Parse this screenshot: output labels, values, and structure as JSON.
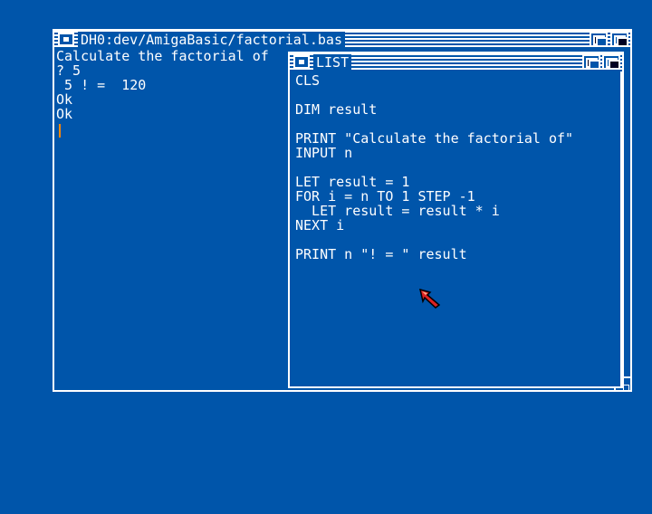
{
  "output_window": {
    "title": "DH0:dev/AmigaBasic/factorial.bas",
    "lines": [
      "Calculate the factorial of",
      "? 5",
      " 5 ! =  120",
      "Ok",
      "Ok"
    ]
  },
  "list_window": {
    "title": "LIST",
    "code_lines": [
      "CLS",
      "",
      "DIM result",
      "",
      "PRINT \"Calculate the factorial of\"",
      "INPUT n",
      "",
      "LET result = 1",
      "FOR i = n TO 1 STEP -1",
      "  LET result = result * i",
      "NEXT i",
      "",
      "PRINT n \"! = \" result"
    ]
  },
  "icons": {
    "close": "close-gadget-icon",
    "depth": "depth-gadget-icon",
    "size": "size-gadget-icon",
    "pointer": "mouse-pointer-icon"
  },
  "colors": {
    "background": "#0055aa",
    "foreground": "#ffffff",
    "cursor": "#ff8800",
    "pointer": "#dd2222"
  }
}
